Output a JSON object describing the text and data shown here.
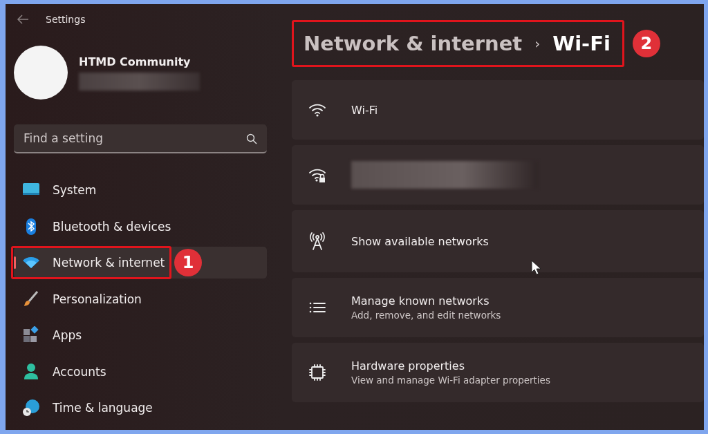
{
  "window": {
    "title": "Settings"
  },
  "profile": {
    "name": "HTMD Community"
  },
  "search": {
    "placeholder": "Find a setting"
  },
  "sidebar": {
    "items": [
      {
        "label": "System",
        "selected": false
      },
      {
        "label": "Bluetooth & devices",
        "selected": false
      },
      {
        "label": "Network & internet",
        "selected": true,
        "step": "1"
      },
      {
        "label": "Personalization",
        "selected": false
      },
      {
        "label": "Apps",
        "selected": false
      },
      {
        "label": "Accounts",
        "selected": false
      },
      {
        "label": "Time & language",
        "selected": false
      }
    ]
  },
  "breadcrumb": {
    "parent": "Network & internet",
    "separator": "›",
    "current": "Wi-Fi",
    "step": "2"
  },
  "cards": [
    {
      "kind": "wifi",
      "title": "Wi-Fi"
    },
    {
      "kind": "wifi-lock"
    },
    {
      "kind": "antenna",
      "title": "Show available networks"
    },
    {
      "kind": "list",
      "title": "Manage known networks",
      "subtitle": "Add, remove, and edit networks"
    },
    {
      "kind": "chip",
      "title": "Hardware properties",
      "subtitle": "View and manage Wi-Fi adapter properties"
    }
  ]
}
